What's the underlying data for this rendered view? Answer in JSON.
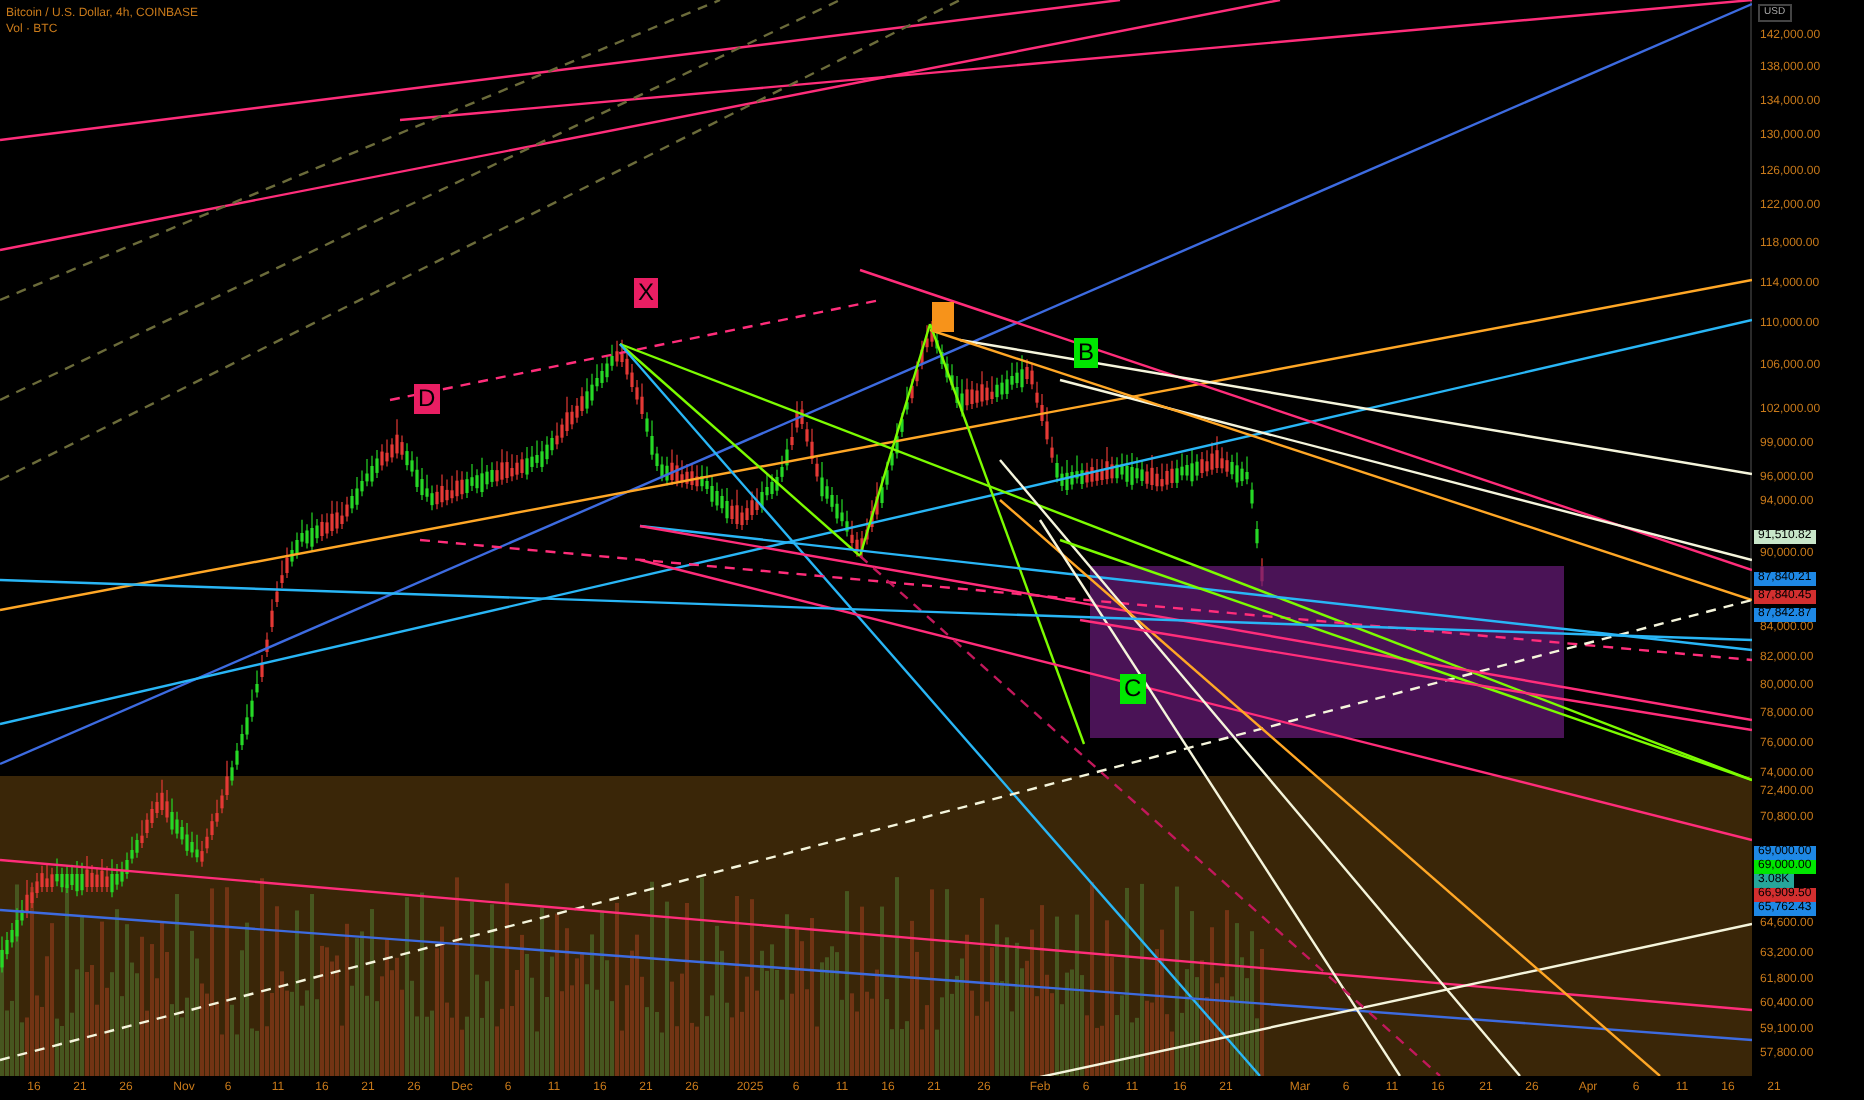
{
  "header": {
    "title": "Bitcoin / U.S. Dollar, 4h, COINBASE",
    "volume_label": "Vol · BTC"
  },
  "price_axis": {
    "currency": "USD",
    "labels": [
      "142,000.00",
      "138,000.00",
      "134,000.00",
      "130,000.00",
      "126,000.00",
      "122,000.00",
      "118,000.00",
      "114,000.00",
      "110,000.00",
      "106,000.00",
      "102,000.00",
      "99,000.00",
      "96,000.00",
      "94,000.00",
      "90,000.00",
      "84,000.00",
      "82,000.00",
      "80,000.00",
      "78,000.00",
      "76,000.00",
      "74,000.00",
      "72,400.00",
      "70,800.00",
      "64,600.00",
      "63,200.00",
      "61,800.00",
      "60,400.00",
      "59,100.00",
      "57,800.00"
    ]
  },
  "price_tags": [
    {
      "label": "91,510.82",
      "color": "#c8e6c9"
    },
    {
      "label": "87,840.21",
      "color": "#1e88e5"
    },
    {
      "label": "87,840.45",
      "color": "#d32f2f"
    },
    {
      "label": "87,842.87",
      "color": "#1e88e5"
    },
    {
      "label": "69,000.00",
      "color": "#1e88e5"
    },
    {
      "label": "69,000.00",
      "color": "#00e600"
    },
    {
      "label": "3.08K",
      "color": "#26a69a"
    },
    {
      "label": "66,909.50",
      "color": "#d32f2f"
    },
    {
      "label": "65,762.43",
      "color": "#1e88e5"
    }
  ],
  "pattern_points": [
    {
      "label": "X",
      "color": "#e91e63"
    },
    {
      "label": "D",
      "color": "#e91e63"
    },
    {
      "label": "B",
      "color": "#00e600"
    },
    {
      "label": "C",
      "color": "#00e600"
    }
  ],
  "time_axis": [
    "16",
    "21",
    "26",
    "Nov",
    "6",
    "11",
    "16",
    "21",
    "26",
    "Dec",
    "6",
    "11",
    "16",
    "21",
    "26",
    "2025",
    "6",
    "11",
    "16",
    "21",
    "26",
    "Feb",
    "6",
    "11",
    "16",
    "21",
    "Mar",
    "6",
    "11",
    "16",
    "21",
    "26",
    "Apr",
    "6",
    "11",
    "16",
    "21"
  ]
}
